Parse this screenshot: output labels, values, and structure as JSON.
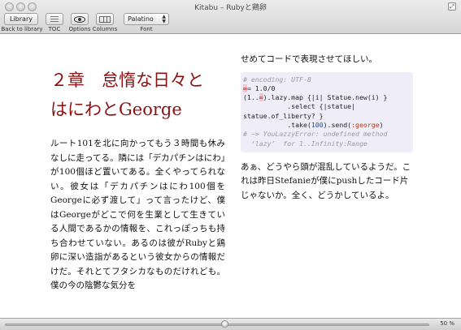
{
  "window": {
    "title": "Kitabu – Rubyと鶏卵",
    "fullscreen_glyph": "⤢"
  },
  "toolbar": {
    "library_label": "Library",
    "library_caption": "Back to library",
    "toc_caption": "TOC",
    "options_caption": "Options",
    "columns_caption": "Columns",
    "font_value": "Palatino",
    "font_caption": "Font"
  },
  "content": {
    "chapter_title_line1": "２章　怠惰な日々と",
    "chapter_title_line2": "はにわとGeorge",
    "body": "ルート101を北に向かってもう３時間も休みなしに走ってる。隣には「デカパチンはにわ」が100個ほど置いてある。全くやってられない。彼女は「デカパチンはにわ100個をGeorgeに必ず渡して」って言ったけど、僕はGeorgeがどこで何を生業として生きている人間であるかの情報を、これっぽっちも持ち合わせていない。あるのは彼がRubyと鶏卵に深い造詣があるという彼女からの情報だけだ。それとてフタシカなものだけれども。僕の今の陰鬱な気分を",
    "right_top": "せめてコードで表現させてほしい。",
    "code": {
      "line1": "# encoding: UTF-8",
      "line2_inf": "∞",
      "line2_rest": "= 1.0/0",
      "line3_a": "(1..",
      "line3_inf": "∞",
      "line3_b": ").lazy.map {|i| Statue.new(i) }",
      "line4": "           .select {|statue|",
      "line5": "statue.of_liberty? }",
      "line6_a": "           .take(",
      "line6_num": "100",
      "line6_b": ").send(",
      "line6_sym": ":george",
      "line6_c": ")",
      "line7": "# ~> YouLazzyError: undefined method",
      "line8": "  ‘lazy’  for 1..Infinity:Range"
    },
    "right_bottom": "あぁ、どうやら頭が混乱しているようだ。これは昨日Stefanieが僕にpushしたコード片じゃないか。全く、どうかしているよ。"
  },
  "statusbar": {
    "progress": 0.52,
    "zoom_label": "50 %"
  }
}
